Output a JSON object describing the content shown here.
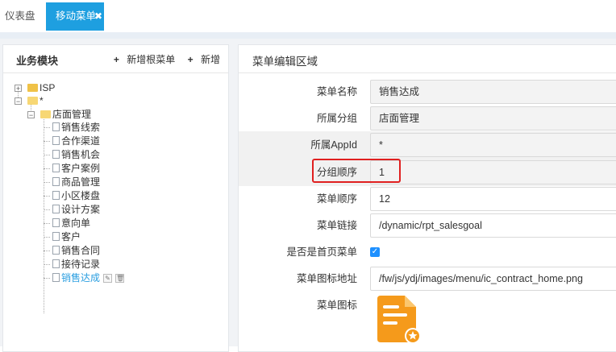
{
  "tabs": {
    "dashboard": "仪表盘",
    "mobile_menu": "移动菜单"
  },
  "left_panel": {
    "title": "业务模块",
    "add_root": "新增根菜单",
    "add": "新增"
  },
  "tree": {
    "isp": "ISP",
    "star": "*",
    "store": "店面管理",
    "items": [
      "销售线索",
      "合作渠道",
      "销售机会",
      "客户案例",
      "商品管理",
      "小区楼盘",
      "设计方案",
      "意向单",
      "客户",
      "销售合同",
      "接待记录"
    ],
    "active": "销售达成"
  },
  "right_panel": {
    "title": "菜单编辑区域"
  },
  "form": {
    "menu_name_label": "菜单名称",
    "menu_name_value": "销售达成",
    "group_label": "所属分组",
    "group_value": "店面管理",
    "appid_label": "所属AppId",
    "appid_value": "*",
    "group_order_label": "分组顺序",
    "group_order_value": "1",
    "menu_order_label": "菜单顺序",
    "menu_order_value": "12",
    "menu_link_label": "菜单链接",
    "menu_link_value": "/dynamic/rpt_salesgoal",
    "is_home_label": "是否是首页菜单",
    "icon_url_label": "菜单图标地址",
    "icon_url_value": "/fw/js/ydj/images/menu/ic_contract_home.png",
    "icon_label": "菜单图标"
  },
  "colors": {
    "accent": "#1e9fe0",
    "highlight": "#e02020",
    "icon_orange": "#f59a1b"
  }
}
